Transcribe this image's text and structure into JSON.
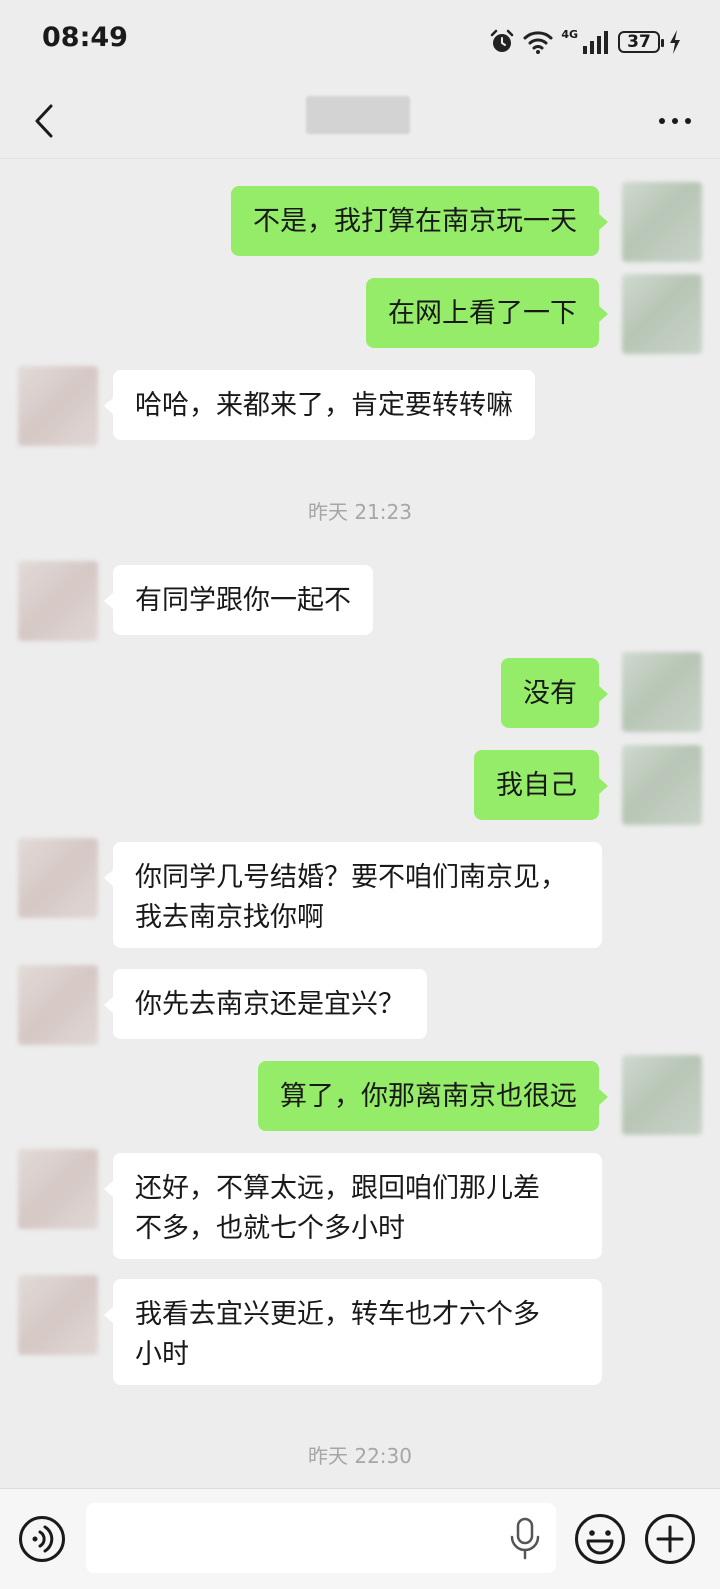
{
  "status_bar": {
    "time": "08:49",
    "network": "4G",
    "battery": "37",
    "icons": [
      "alarm-icon",
      "wifi-icon",
      "signal-icon",
      "battery-icon",
      "charging-icon"
    ]
  },
  "nav": {
    "back_icon": "chevron-left-icon",
    "more_icon": "more-dots-icon"
  },
  "messages": [
    {
      "side": "self",
      "text": "不是，我打算在南京玩一天"
    },
    {
      "side": "self",
      "text": "在网上看了一下"
    },
    {
      "side": "other",
      "text": "哈哈，来都来了，肯定要转转嘛"
    },
    {
      "type": "time",
      "text": "昨天 21:23"
    },
    {
      "side": "other",
      "text": "有同学跟你一起不"
    },
    {
      "side": "self",
      "text": "没有"
    },
    {
      "side": "self",
      "text": "我自己"
    },
    {
      "side": "other",
      "text": "你同学几号结婚？要不咱们南京见，\n我去南京找你啊"
    },
    {
      "side": "other",
      "text": "你先去南京还是宜兴？"
    },
    {
      "side": "self",
      "text": "算了，你那离南京也很远"
    },
    {
      "side": "other",
      "text": "还好，不算太远，跟回咱们那儿差\n不多，也就七个多小时"
    },
    {
      "side": "other",
      "text": "我看去宜兴更近，转车也才六个多\n小时"
    },
    {
      "type": "time",
      "text": "昨天 22:30"
    }
  ],
  "input_bar": {
    "placeholder": "",
    "icons": [
      "voice-icon",
      "mic-icon",
      "emoji-icon",
      "plus-icon"
    ]
  }
}
